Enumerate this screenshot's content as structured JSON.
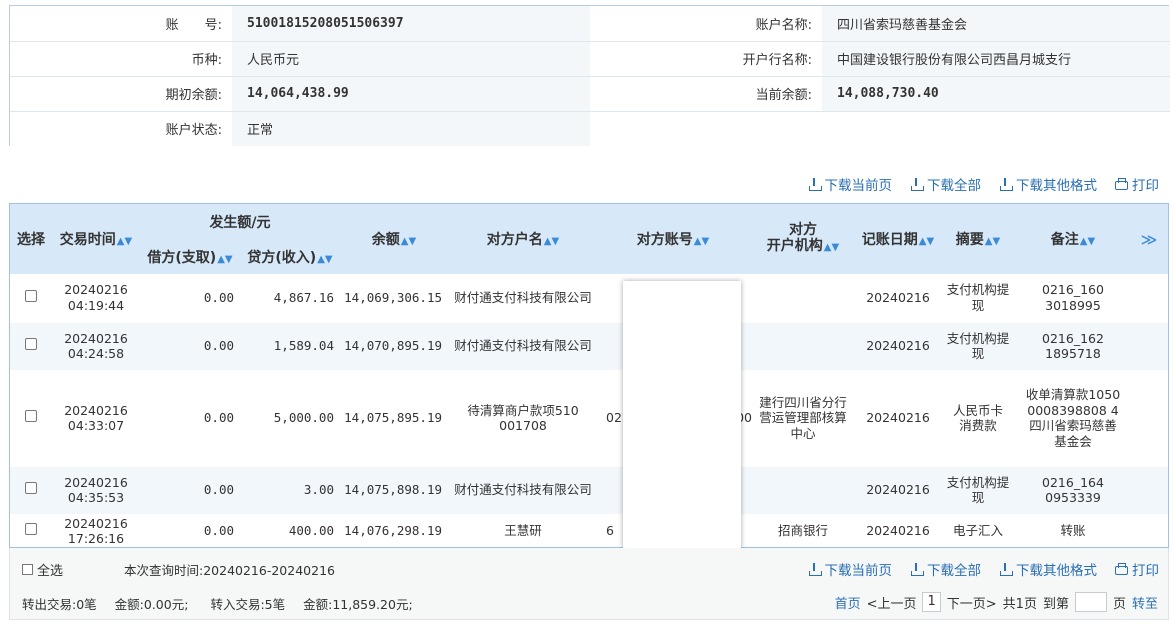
{
  "account": {
    "account_no_label": "账　　号:",
    "account_no": "51001815208051506397",
    "account_name_label": "账户名称:",
    "account_name": "四川省索玛慈善基金会",
    "currency_label": "币种:",
    "currency": "人民币元",
    "bank_label": "开户行名称:",
    "bank": "中国建设银行股份有限公司西昌月城支行",
    "opening_balance_label": "期初余额:",
    "opening_balance": "14,064,438.99",
    "current_balance_label": "当前余额:",
    "current_balance": "14,088,730.40",
    "status_label": "账户状态:",
    "status": "正常"
  },
  "toolbar": {
    "download_page": "下载当前页",
    "download_all": "下载全部",
    "download_other": "下载其他格式",
    "print": "打印"
  },
  "table": {
    "headers": {
      "select": "选择",
      "time": "交易时间",
      "amount_group": "发生额/元",
      "debit": "借方(支取)",
      "credit": "贷方(收入)",
      "balance": "余额",
      "counterparty_name": "对方户名",
      "counterparty_account": "对方账号",
      "counterparty_bank": "对方\n开户机构",
      "book_date": "记账日期",
      "summary": "摘要",
      "remark": "备注",
      "more": "≫"
    },
    "rows": [
      {
        "date": "20240216",
        "time": "04:19:44",
        "debit": "0.00",
        "credit": "4,867.16",
        "balance": "14,069,306.15",
        "name": "财付通支付科技有限公司",
        "account": "",
        "bank": "",
        "book_date": "20240216",
        "summary": "支付机构提现",
        "remark": "0216_1603018995"
      },
      {
        "date": "20240216",
        "time": "04:24:58",
        "debit": "0.00",
        "credit": "1,589.04",
        "balance": "14,070,895.19",
        "name": "财付通支付科技有限公司",
        "account": "",
        "bank": "",
        "book_date": "20240216",
        "summary": "支付机构提现",
        "remark": "0216_1621895718"
      },
      {
        "date": "20240216",
        "time": "04:33:07",
        "debit": "0.00",
        "credit": "5,000.00",
        "balance": "14,075,895.19",
        "name": "待清算商户款项510001708",
        "account": "02",
        "account_tail": "00",
        "bank": "建行四川省分行营运管理部核算中心",
        "book_date": "20240216",
        "summary": "人民币卡消费款",
        "remark": "收单清算款10500008398808 4四川省索玛慈善基金会"
      },
      {
        "date": "20240216",
        "time": "04:35:53",
        "debit": "0.00",
        "credit": "3.00",
        "balance": "14,075,898.19",
        "name": "财付通支付科技有限公司",
        "account": "",
        "bank": "",
        "book_date": "20240216",
        "summary": "支付机构提现",
        "remark": "0216_1640953339"
      },
      {
        "date": "20240216",
        "time": "17:26:16",
        "debit": "0.00",
        "credit": "400.00",
        "balance": "14,076,298.19",
        "name": "王慧研",
        "account": "6",
        "bank": "招商银行",
        "book_date": "20240216",
        "summary": "电子汇入",
        "remark": "转账"
      }
    ]
  },
  "footer": {
    "select_all": "全选",
    "query_time": "本次查询时间:20240216-20240216",
    "out_count": "转出交易:0笔",
    "out_amount": "金额:0.00元;",
    "in_count": "转入交易:5笔",
    "in_amount": "金额:11,859.20元;",
    "first": "首页",
    "prev": "<上一页",
    "current_page": "1",
    "next": "下一页>",
    "total": "共1页",
    "goto_prefix": "到第",
    "goto_suffix": "页",
    "go": "转至"
  },
  "colors": {
    "link": "#2a6fb5",
    "header_bg": "#d7e8f8",
    "row_alt": "#f2f7fc"
  }
}
